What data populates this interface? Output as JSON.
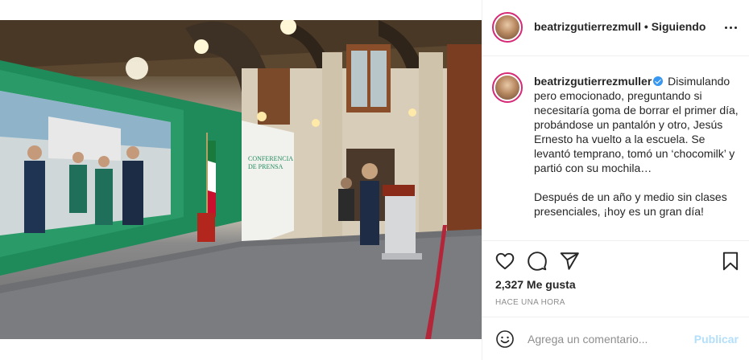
{
  "post": {
    "image_alt": "",
    "screen_labels": {
      "conference_line1": "CONFERENCIA",
      "conference_line2": "DE PRENSA"
    }
  },
  "header": {
    "username": "beatrizgutierrezmull",
    "separator": "•",
    "follow_status": "Siguiendo",
    "more_icon": "more-dots-icon"
  },
  "caption": {
    "username": "beatrizgutierrezmuller",
    "verified_icon": "verified-badge-icon",
    "paragraph1": "Disimulando pero emocionado, preguntando si necesitaría goma de borrar el primer día, probándose un pantalón y otro, Jesús Ernesto ha vuelto a la escuela. Se levantó temprano, tomó un ‘chocomilk’ y partió con su mochila…",
    "paragraph2": "Después de un año y medio sin clases presenciales, ¡hoy es un gran día!"
  },
  "actions": {
    "like_icon": "heart-icon",
    "comment_icon": "comment-bubble-icon",
    "share_icon": "paper-plane-icon",
    "save_icon": "bookmark-icon"
  },
  "likes": {
    "text": "2,327 Me gusta"
  },
  "timestamp": "HACE UNA HORA",
  "comment_box": {
    "emoji_icon": "emoji-smile-icon",
    "placeholder": "Agrega un comentario...",
    "post_label": "Publicar",
    "post_color": "#b2dffc"
  },
  "colors": {
    "avatar_ring": "#d62976",
    "verified": "#3897f0",
    "text": "#262626",
    "muted": "#8e8e8e",
    "screen_green": "#1f8a5a"
  }
}
